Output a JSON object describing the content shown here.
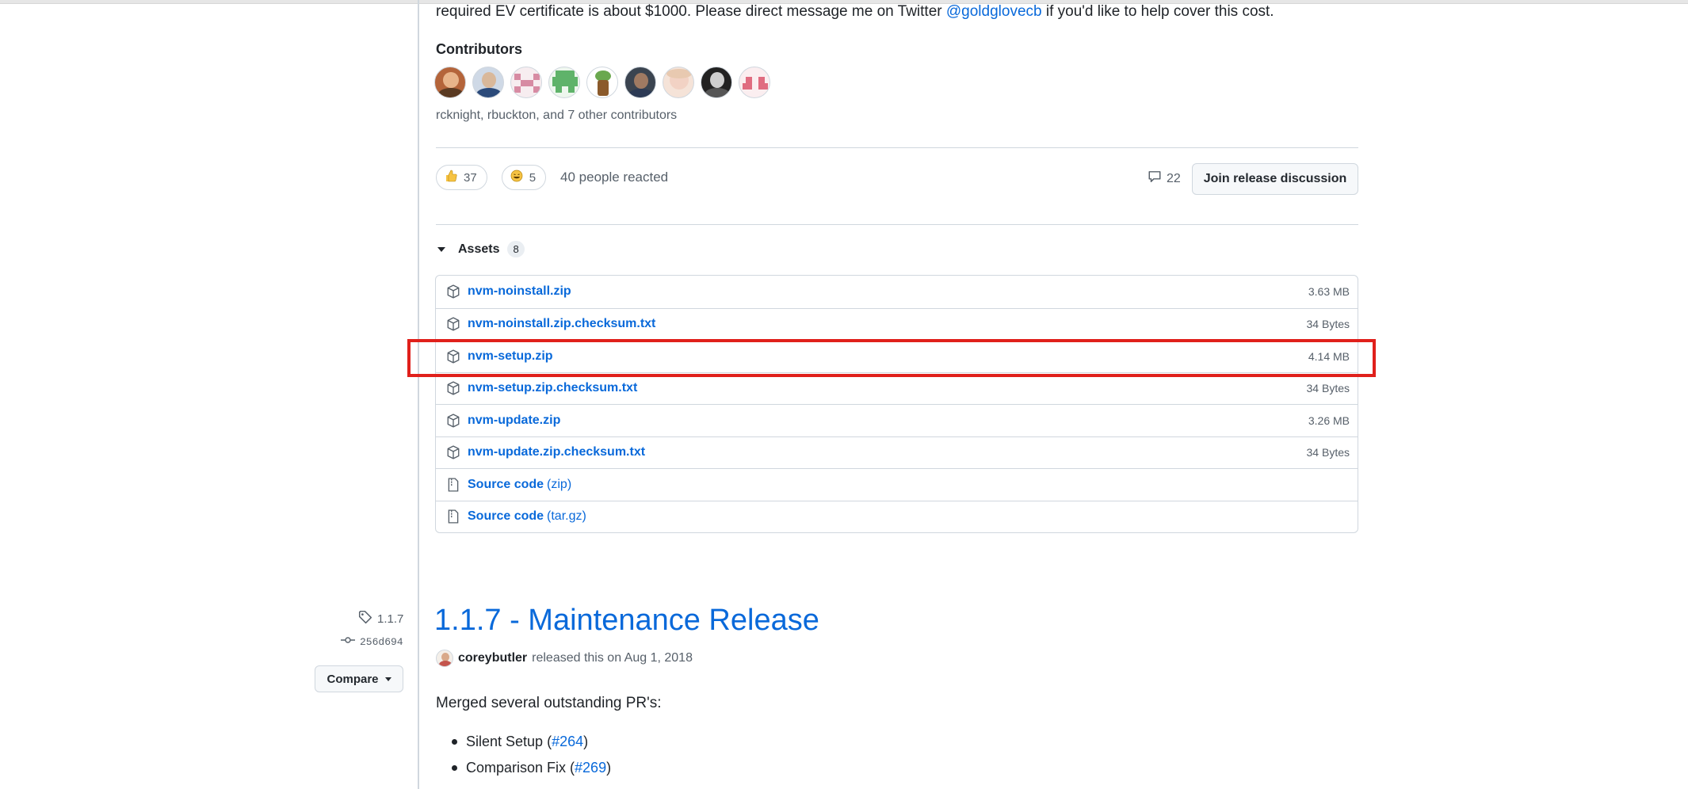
{
  "release_prev": {
    "ev_text_before": "required EV certificate is about $1000. Please direct message me on Twitter ",
    "ev_link": "@goldglovecb",
    "ev_text_after": " if you'd like to help cover this cost.",
    "contributors_title": "Contributors",
    "contributors_text": "rcknight, rbuckton, and 7 other contributors",
    "reactions": [
      {
        "emoji": "thumbs-up-icon",
        "count": "37"
      },
      {
        "emoji": "laugh-icon",
        "count": "5"
      }
    ],
    "reacted_text": "40 people reacted",
    "comment_count": "22",
    "join_button": "Join release discussion",
    "assets_label": "Assets",
    "assets_count": "8",
    "assets": [
      {
        "name": "nvm-noinstall.zip",
        "suffix": "",
        "size": "3.63 MB",
        "icon": "package-icon"
      },
      {
        "name": "nvm-noinstall.zip.checksum.txt",
        "suffix": "",
        "size": "34 Bytes",
        "icon": "package-icon"
      },
      {
        "name": "nvm-setup.zip",
        "suffix": "",
        "size": "4.14 MB",
        "icon": "package-icon"
      },
      {
        "name": "nvm-setup.zip.checksum.txt",
        "suffix": "",
        "size": "34 Bytes",
        "icon": "package-icon"
      },
      {
        "name": "nvm-update.zip",
        "suffix": "",
        "size": "3.26 MB",
        "icon": "package-icon"
      },
      {
        "name": "nvm-update.zip.checksum.txt",
        "suffix": "",
        "size": "34 Bytes",
        "icon": "package-icon"
      },
      {
        "name": "Source code",
        "suffix": "(zip)",
        "size": "",
        "icon": "file-zip-icon"
      },
      {
        "name": "Source code",
        "suffix": "(tar.gz)",
        "size": "",
        "icon": "file-zip-icon"
      }
    ]
  },
  "release_next": {
    "tag": "1.1.7",
    "commit": "256d694",
    "compare_label": "Compare",
    "title": "1.1.7 - Maintenance Release",
    "author": "coreybutler",
    "released_text": "released this on Aug 1, 2018",
    "body": "Merged several outstanding PR's:",
    "bullets": [
      {
        "text": "Silent Setup (",
        "link": "#264",
        "close": ")"
      },
      {
        "text": "Comparison Fix (",
        "link": "#269",
        "close": ")"
      }
    ]
  },
  "colors": {
    "link": "#0969da",
    "highlight": "#e0201b",
    "border": "#d0d7de"
  }
}
